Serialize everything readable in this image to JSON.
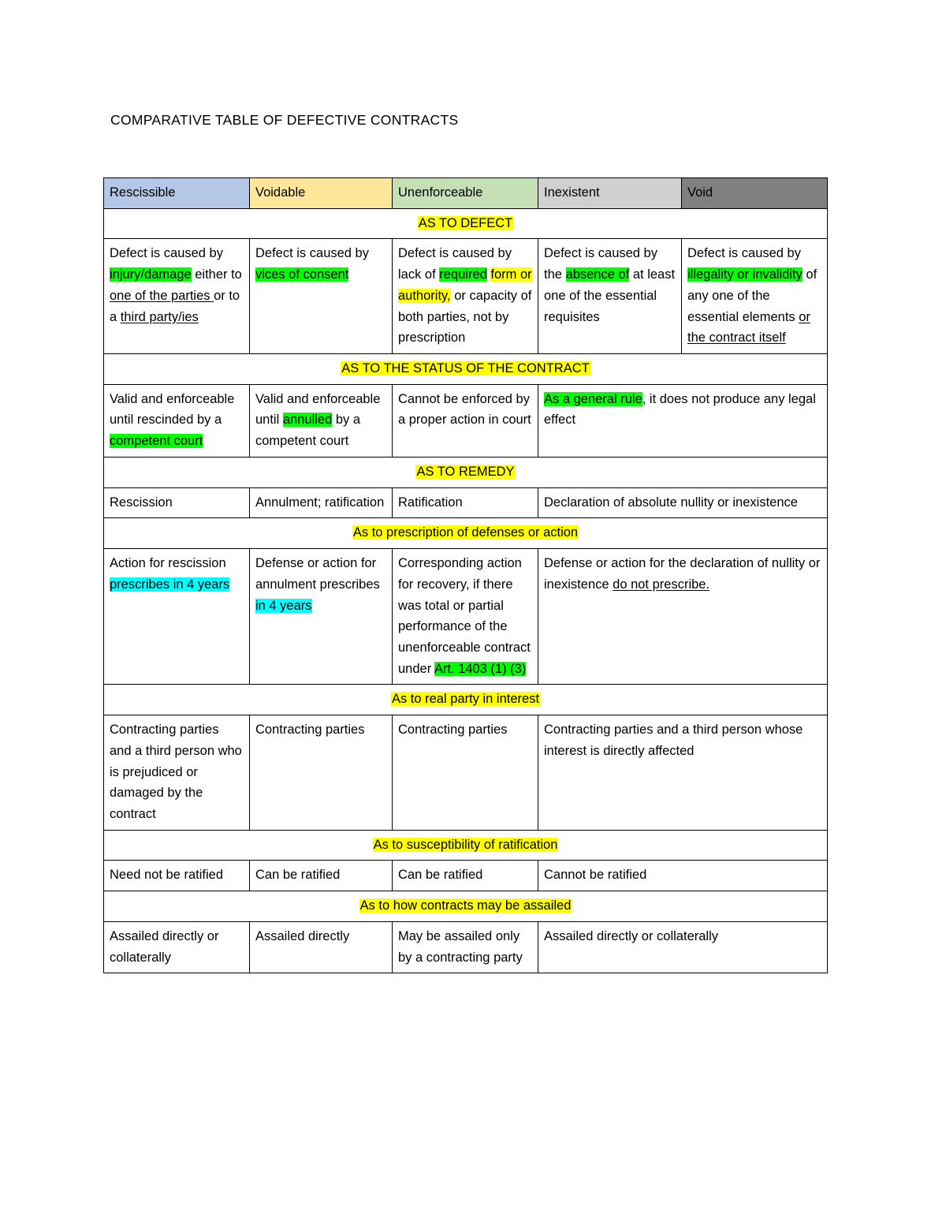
{
  "document": {
    "title": "COMPARATIVE TABLE OF DEFECTIVE CONTRACTS"
  },
  "colors": {
    "rescissible_header": "#B4C7E7",
    "voidable_header": "#FFE699",
    "unenforceable_header": "#C5E0B4",
    "inexistent_header": "#D0D0D0",
    "void_header": "#808080",
    "highlight_yellow": "#FFFF00",
    "highlight_green": "#00FF00",
    "highlight_cyan": "#00FFFF",
    "border": "#000000"
  },
  "table": {
    "columns": [
      {
        "label": "Rescissible",
        "bg": "#B4C7E7"
      },
      {
        "label": "Voidable",
        "bg": "#FFE699"
      },
      {
        "label": "Unenforceable",
        "bg": "#C5E0B4"
      },
      {
        "label": "Inexistent",
        "bg": "#D0D0D0"
      },
      {
        "label": "Void",
        "bg": "#808080"
      }
    ],
    "sections": [
      {
        "heading": "AS TO DEFECT",
        "layout": "five",
        "cells": [
          "Defect is caused by injury/damage either to one of the parties or to a third party/ies",
          "Defect is caused by vices of consent",
          "Defect is caused by lack of required form or authority, or capacity of both parties, not by prescription",
          "Defect is caused by the absence of at least one of the essential requisites",
          "Defect is caused by illegality or invalidity of any one of the essential elements or the contract itself"
        ]
      },
      {
        "heading": "AS TO THE STATUS OF THE CONTRACT",
        "layout": "four",
        "cells": [
          "Valid and enforceable until rescinded by a competent court",
          "Valid and enforceable until annulled by a competent court",
          "Cannot be enforced by a proper action in court",
          "As a general rule, it does not produce any legal effect"
        ]
      },
      {
        "heading": "AS TO REMEDY",
        "layout": "four",
        "cells": [
          "Rescission",
          "Annulment; ratification",
          "Ratification",
          "Declaration of absolute nullity or inexistence"
        ]
      },
      {
        "heading": "As to prescription of defenses or action",
        "layout": "four",
        "cells": [
          "Action for rescission prescribes in 4 years",
          "Defense or action for annulment prescribes in 4 years",
          "Corresponding action for recovery, if there was total or partial performance of the unenforceable contract under Art. 1403 (1) (3)",
          "Defense or action for the declaration of nullity or inexistence do not prescribe."
        ]
      },
      {
        "heading": "As to real party in interest",
        "layout": "four",
        "cells": [
          "Contracting parties and a third person who is prejudiced or damaged by the contract",
          "Contracting parties",
          "Contracting parties",
          "Contracting parties and a third person whose interest is directly affected"
        ]
      },
      {
        "heading": "As to susceptibility of ratification",
        "layout": "four",
        "cells": [
          "Need not be ratified",
          "Can be ratified",
          "Can be ratified",
          "Cannot be ratified"
        ]
      },
      {
        "heading": "As to how contracts may be assailed",
        "layout": "four",
        "cells": [
          "Assailed directly or collaterally",
          "Assailed directly",
          "May be assailed only by a contracting party",
          "Assailed directly or collaterally"
        ]
      }
    ]
  },
  "fragments": {
    "defect_r_1": "Defect is caused by ",
    "defect_r_2": "injury/damage",
    "defect_r_3": " either to ",
    "defect_r_4": "one of the parties ",
    "defect_r_5": "or to a ",
    "defect_r_6": "third party/ies",
    "defect_v_1": "Defect is caused by ",
    "defect_v_2": "vices of consent",
    "defect_u_1": "Defect is caused by lack of ",
    "defect_u_2": "required",
    "defect_u_3": "form or authority,",
    "defect_u_4": " or capacity of both parties, not by prescription",
    "defect_i_1": "Defect is caused by the ",
    "defect_i_2": "absence of",
    "defect_i_3": " at least one of the essential requisites",
    "defect_vo_1": "Defect is caused by ",
    "defect_vo_2": "illegality or invalidity",
    "defect_vo_3": " of any one of the essential elements ",
    "defect_vo_4": "or the contract itself",
    "status_r_1": "Valid and enforceable until rescinded by a ",
    "status_r_2": "competent court",
    "status_v_1": "Valid and enforceable until ",
    "status_v_2": "annulled",
    "status_v_3": " by a competent court",
    "status_u_1": "Cannot be enforced by a proper action in court",
    "status_i_1": "As a general rule",
    "status_i_2": ", it does not produce any legal effect",
    "remedy_r": "Rescission",
    "remedy_v": "Annulment; ratification",
    "remedy_u": "Ratification",
    "remedy_i": "Declaration of absolute nullity or inexistence",
    "presc_r_1": "Action for rescission ",
    "presc_r_2": "prescribes in 4 years",
    "presc_v_1": "Defense or action for annulment prescribes ",
    "presc_v_2": "in 4 years",
    "presc_u_1": "Corresponding action for recovery, if there was total or partial performance of the unenforceable contract under ",
    "presc_u_2": "Art. 1403 (1) (3)",
    "presc_i_1": "Defense or action for the declaration of nullity or inexistence ",
    "presc_i_2": "do not prescribe.",
    "party_r": "Contracting parties and a third person who is prejudiced or damaged by the contract",
    "party_v": "Contracting parties",
    "party_u": "Contracting parties",
    "party_i": "Contracting parties and a third person whose interest is directly affected",
    "ratif_r": "Need not be ratified",
    "ratif_v": "Can be ratified",
    "ratif_u": "Can be ratified",
    "ratif_i": "Cannot be ratified",
    "assail_r": "Assailed directly or collaterally",
    "assail_v": "Assailed directly",
    "assail_u": "May be assailed only by a contracting party",
    "assail_i": "Assailed directly or collaterally"
  }
}
